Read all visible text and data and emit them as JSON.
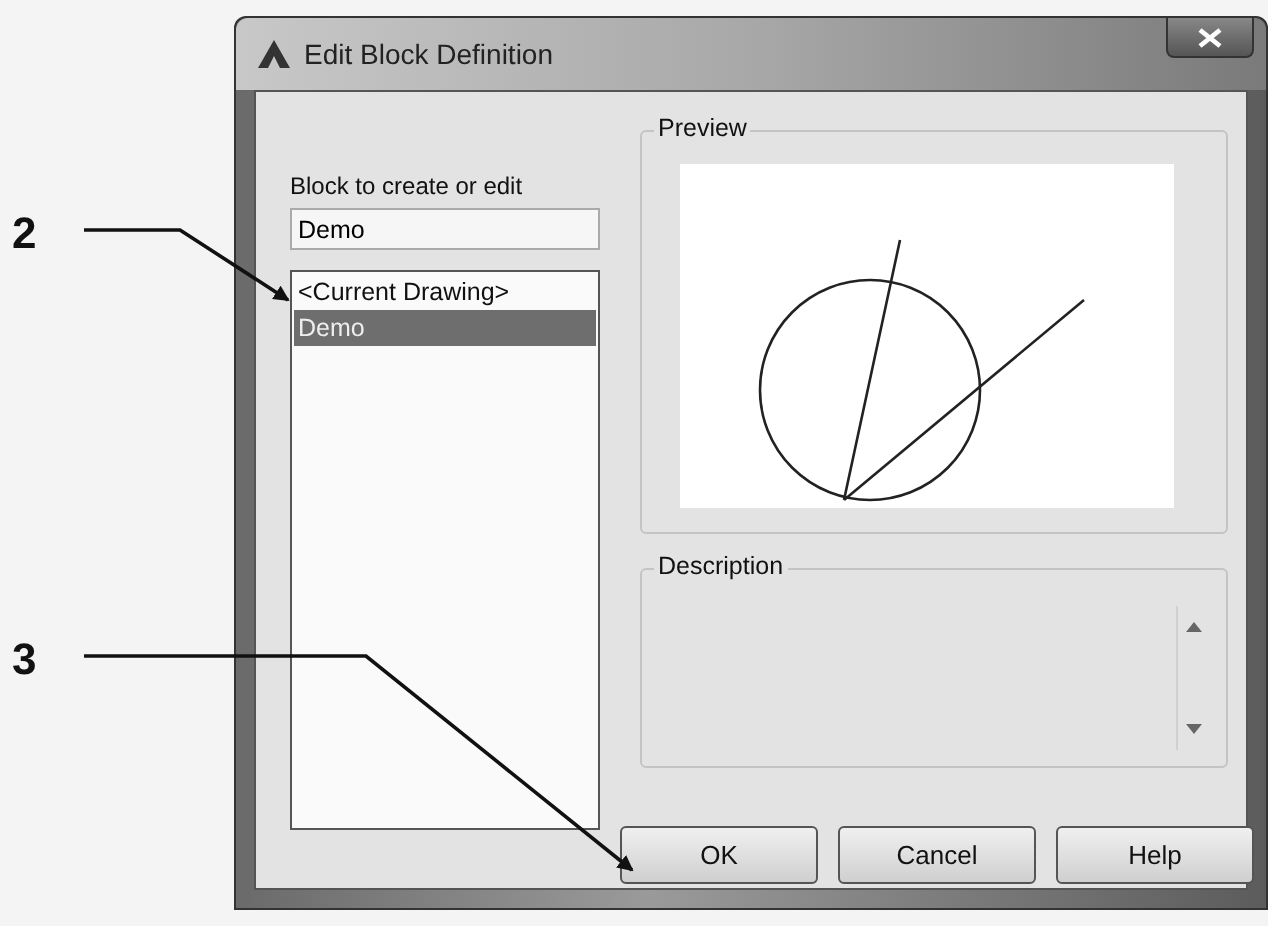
{
  "window": {
    "title": "Edit Block Definition"
  },
  "block_field": {
    "label": "Block to create or edit",
    "value": "Demo"
  },
  "block_list": {
    "items": [
      {
        "label": "<Current Drawing>",
        "selected": false
      },
      {
        "label": "Demo",
        "selected": true
      }
    ]
  },
  "preview": {
    "label": "Preview"
  },
  "description": {
    "label": "Description"
  },
  "buttons": [
    {
      "label": "OK"
    },
    {
      "label": "Cancel"
    },
    {
      "label": "Help"
    }
  ],
  "callouts": [
    {
      "label": "2",
      "kind": "list"
    },
    {
      "label": "3",
      "kind": "button"
    }
  ]
}
